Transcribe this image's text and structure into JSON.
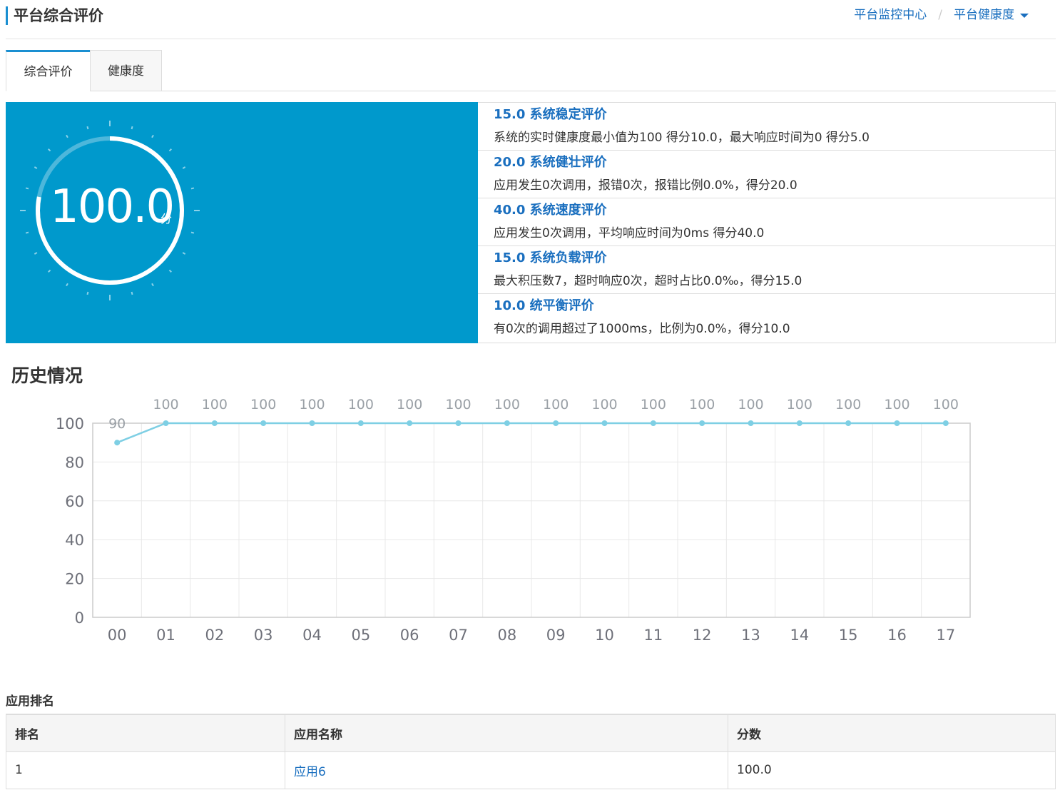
{
  "header": {
    "title": "平台综合评价",
    "breadcrumb": [
      "平台监控中心",
      "平台健康度"
    ]
  },
  "tabs": [
    {
      "label": "综合评价",
      "active": true
    },
    {
      "label": "健康度",
      "active": false
    }
  ],
  "score": {
    "value": "100.0",
    "unit": "分",
    "fraction": 1.0
  },
  "evaluations": [
    {
      "title": "15.0 系统稳定评价",
      "desc": "系统的实时健康度最小值为100 得分10.0，最大响应时间为0 得分5.0"
    },
    {
      "title": "20.0 系统健壮评价",
      "desc": "应用发生0次调用，报错0次，报错比例0.0%，得分20.0"
    },
    {
      "title": "40.0 系统速度评价",
      "desc": "应用发生0次调用，平均响应时间为0ms 得分40.0"
    },
    {
      "title": "15.0 系统负载评价",
      "desc": "最大积压数7，超时响应0次，超时占比0.0‰，得分15.0"
    },
    {
      "title": "10.0 统平衡评价",
      "desc": "有0次的调用超过了1000ms，比例为0.0%，得分10.0"
    }
  ],
  "history": {
    "title": "历史情况"
  },
  "chart_data": {
    "type": "line",
    "x": [
      "00",
      "01",
      "02",
      "03",
      "04",
      "05",
      "06",
      "07",
      "08",
      "09",
      "10",
      "11",
      "12",
      "13",
      "14",
      "15",
      "16",
      "17"
    ],
    "values": [
      90,
      100,
      100,
      100,
      100,
      100,
      100,
      100,
      100,
      100,
      100,
      100,
      100,
      100,
      100,
      100,
      100,
      100
    ],
    "yticks": [
      0,
      20,
      40,
      60,
      80,
      100
    ],
    "ylim": [
      0,
      100
    ],
    "grid": true,
    "color": "#7ecfe4"
  },
  "ranking": {
    "title": "应用排名",
    "columns": [
      "排名",
      "应用名称",
      "分数"
    ],
    "rows": [
      {
        "rank": "1",
        "name": "应用6",
        "score": "100.0"
      }
    ]
  },
  "colors": {
    "accent": "#1a8fd1",
    "panel": "#0099cc",
    "link": "#1a6fbf"
  }
}
